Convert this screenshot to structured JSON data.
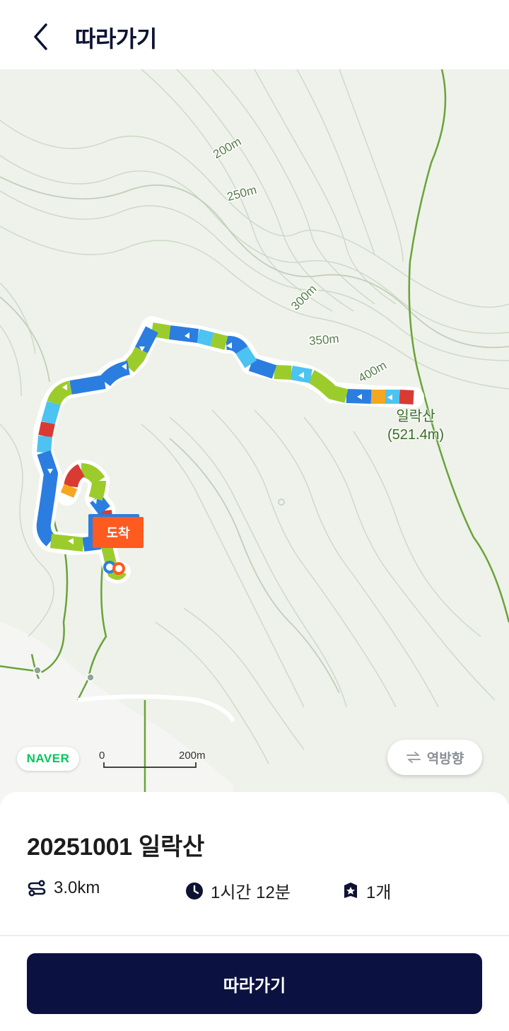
{
  "header": {
    "title": "따라가기",
    "back_icon": "chevron-left-icon"
  },
  "map": {
    "contour_labels": [
      "200m",
      "250m",
      "300m",
      "350m",
      "400m"
    ],
    "summit": {
      "name": "일락산",
      "elevation": "(521.4m)"
    },
    "arrival_label": "도착",
    "provider_logo": "NAVER",
    "scale": {
      "zero": "0",
      "max": "200m"
    },
    "reverse_button": {
      "label": "역방향",
      "icon": "swap-arrows-icon"
    },
    "segment_colors": {
      "blue": "#2b7de0",
      "cyan": "#4cc3f0",
      "green": "#9ccc2c",
      "red": "#d93a32",
      "orange": "#f5a623"
    }
  },
  "trail": {
    "name": "20251001 일락산",
    "distance": "3.0km",
    "duration": "1시간 12분",
    "count": "1개"
  },
  "follow_button": {
    "label": "따라가기"
  }
}
